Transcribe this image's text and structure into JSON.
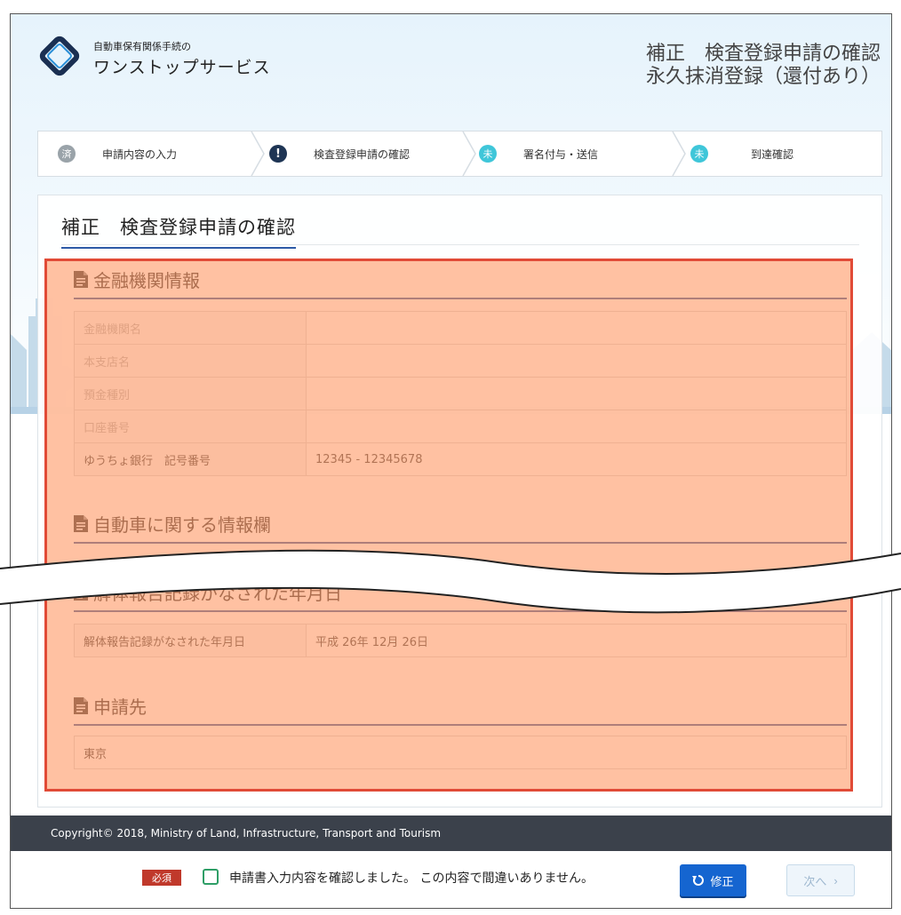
{
  "header": {
    "logo_small": "自動車保有関係手続の",
    "logo_big": "ワンストップサービス",
    "title_line1": "補正　検査登録申請の確認",
    "title_line2": "永久抹消登録（還付あり）"
  },
  "steps": [
    {
      "badge": "済",
      "label": "申請内容の入力",
      "state": "done"
    },
    {
      "badge": "!",
      "label": "検査登録申請の確認",
      "state": "current"
    },
    {
      "badge": "未",
      "label": "署名付与・送信",
      "state": "todo"
    },
    {
      "badge": "未",
      "label": "到達確認",
      "state": "todo"
    }
  ],
  "card": {
    "title": "補正　検査登録申請の確認"
  },
  "sections": {
    "bank": {
      "heading": "金融機関情報",
      "rows": [
        {
          "key": "金融機関名",
          "value": ""
        },
        {
          "key": "本支店名",
          "value": ""
        },
        {
          "key": "預金種別",
          "value": ""
        },
        {
          "key": "口座番号",
          "value": ""
        },
        {
          "key": "ゆうちょ銀行　記号番号",
          "value": "12345 - 12345678"
        }
      ]
    },
    "vehicle": {
      "heading": "自動車に関する情報欄"
    },
    "dismantle": {
      "heading": "解体報告記録がなされた年月日",
      "rows": [
        {
          "key": "解体報告記録がなされた年月日",
          "value": "平成 26年 12月 26日"
        }
      ]
    },
    "destination": {
      "heading": "申請先",
      "value": "東京"
    }
  },
  "footer": {
    "copyright": "Copyright© 2018, Ministry of Land, Infrastructure, Transport and Tourism",
    "required": "必須",
    "confirm_text": "申請書入力内容を確認しました。 この内容で間違いありません。",
    "fix_label": "修正",
    "next_label": "次へ"
  },
  "colors": {
    "primary": "#1565d0",
    "navy": "#1e3554",
    "todo": "#3fc6d9",
    "highlight": "#e14b37"
  }
}
